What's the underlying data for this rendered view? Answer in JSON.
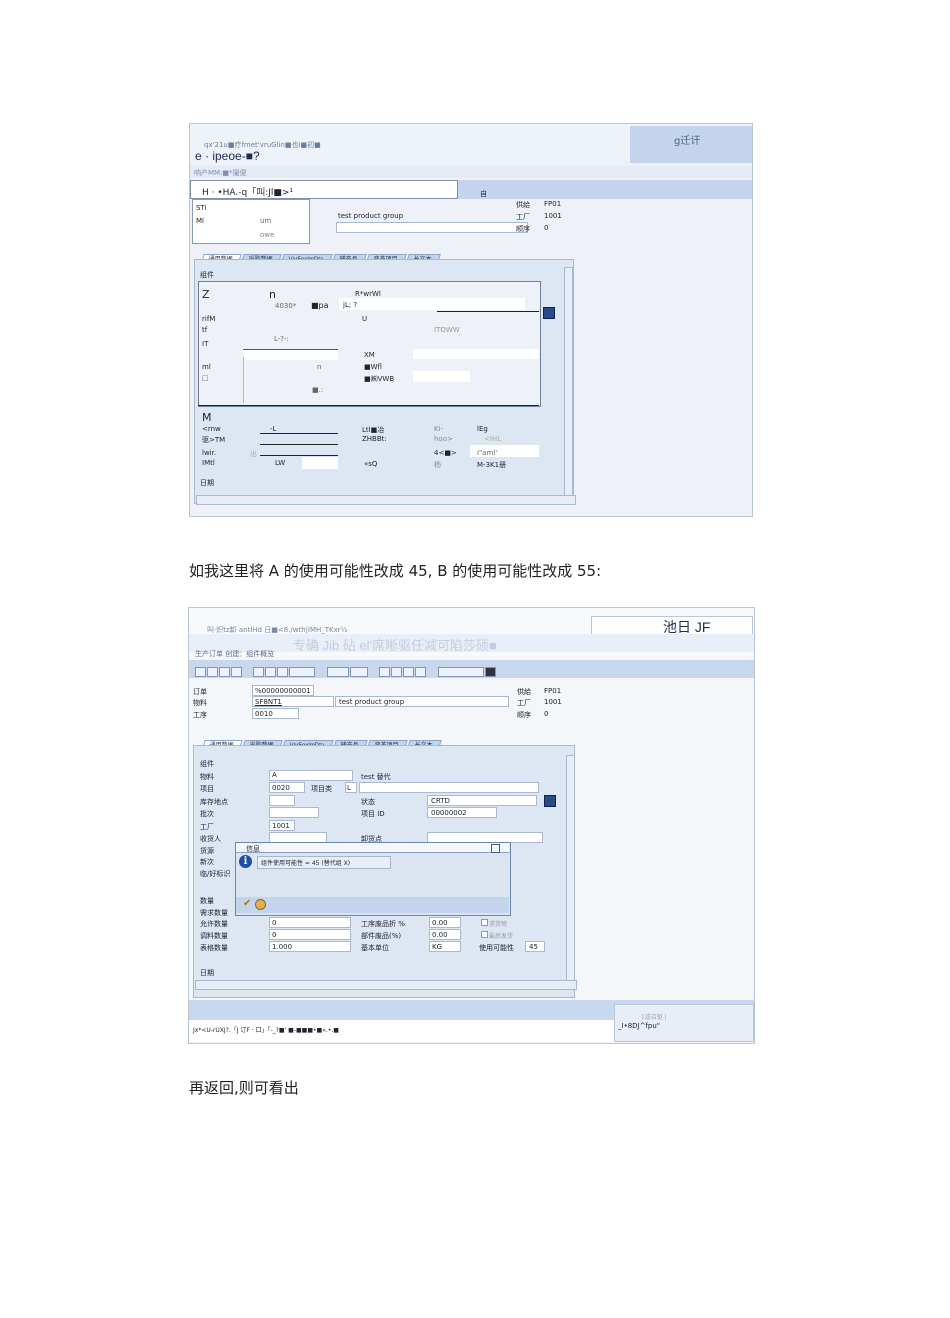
{
  "shot1": {
    "header_line": "qx'21u■疗fmet'vruGlin■也i■初■",
    "title": "e · ipeoe-■?",
    "right_label": "g迁讦",
    "subline": "响产MM:■*撮便",
    "menu_title": "H · •HA.-q「叫:Jl■>¹",
    "menu_right": "自",
    "dropdown": [
      "STi",
      "Ml",
      "um",
      "owe"
    ],
    "info_right": [
      [
        "供給",
        "FP01"
      ],
      [
        "工厂",
        "1001"
      ],
      [
        "顺序",
        "0"
      ]
    ],
    "group_text": "test product group",
    "tabs": [
      "通用数据",
      "采购数据",
      "Var5ox!mDta",
      "辅产品",
      "变革项目",
      "长文本"
    ],
    "section1": "组件",
    "section2": "M",
    "section3": "日期",
    "rows": [
      [
        "Z",
        "n",
        "R*wrWl",
        ""
      ],
      [
        "",
        "4030*",
        "■pa",
        "jL; ?"
      ],
      [
        "rifM",
        "",
        "U",
        ""
      ],
      [
        "tf",
        "",
        "",
        "ITOWW"
      ],
      [
        "IT",
        "L-?-:",
        "",
        ""
      ],
      [
        "",
        "",
        "XM",
        ""
      ],
      [
        "ml",
        "n",
        "■Wfl",
        ""
      ],
      [
        "□",
        "",
        "■㈱VWB",
        ""
      ],
      [
        "",
        "■.:",
        "",
        ""
      ]
    ],
    "qty_rows": [
      [
        "<rnw",
        "-L",
        "Ltl■冶",
        "Ki-",
        "lEg"
      ],
      [
        "驱>TM",
        "",
        "ZHBBt:",
        "hoo>",
        "<IHL"
      ],
      [
        "lwir.",
        "出",
        "",
        "4<■>",
        "i\"aml'"
      ],
      [
        "IMtl",
        "LW",
        "«sQ",
        "杨",
        "M-3K1册"
      ]
    ]
  },
  "caption1": "如我这里将 A 的使用可能性改成 45, B 的使用可能性改成 55:",
  "shot2": {
    "header_line": "叫·炽tz卸    antlHd 日■<8./wth|lMH_TKxr½",
    "right_title": "池日 JF",
    "blurred_title": "专确 Jib 砧 el'席晰驱任减可陷莎硕■",
    "app_title": "生产订单 创建：组件概览",
    "order_fields": [
      [
        "订单",
        "%00000000001"
      ],
      [
        "物料",
        "SF8NT1",
        "test product group"
      ],
      [
        "工序",
        "0010"
      ]
    ],
    "info_right": [
      [
        "供給",
        "FP01"
      ],
      [
        "工厂",
        "1001"
      ],
      [
        "顺序",
        "0"
      ]
    ],
    "tabs": [
      "通用数据",
      "采购数据",
      "Var5ox!mDta",
      "辅产品",
      "变革项目",
      "长文本"
    ],
    "section_component": "组件",
    "component_rows": [
      [
        "物料",
        "A",
        "test 替代"
      ],
      [
        "项目",
        "0020",
        "项目类",
        "L"
      ],
      [
        "库存地点",
        "",
        "状态",
        "CRTD"
      ],
      [
        "批次",
        "",
        "项目 ID",
        "00000002"
      ],
      [
        "工厂",
        "1001",
        "",
        ""
      ],
      [
        "收货人",
        "",
        "卸货点",
        ""
      ],
      [
        "货源",
        "",
        "",
        ""
      ],
      [
        "新次",
        "",
        "",
        ""
      ],
      [
        "临/好标识",
        "",
        "",
        ""
      ]
    ],
    "popup_title": "信息",
    "popup_message": "组件使用可能性 = 45 (替代组 X)",
    "section_qty": "数量",
    "qty_rows": [
      [
        "需求数量",
        "",
        "",
        "",
        "",
        ""
      ],
      [
        "允许数量",
        "0",
        "工序废品折 %",
        "0.00",
        "求货物",
        ""
      ],
      [
        "调料数量",
        "0",
        "部件废品(%)",
        "0.00",
        "最后发货",
        ""
      ],
      [
        "表格数量",
        "1.000",
        "基本单位",
        "KG",
        "使用可能性",
        "45"
      ]
    ],
    "section_date": "日期",
    "status_left": "Jx*<U-rUXJ?.「J 订F · 口」「-_?■' ■-■■■•■«.•.■",
    "status_right": "_I•8DJ^fpu\"",
    "status_right_small": "1或召驱 |"
  },
  "caption2": "再返回,则可看出"
}
